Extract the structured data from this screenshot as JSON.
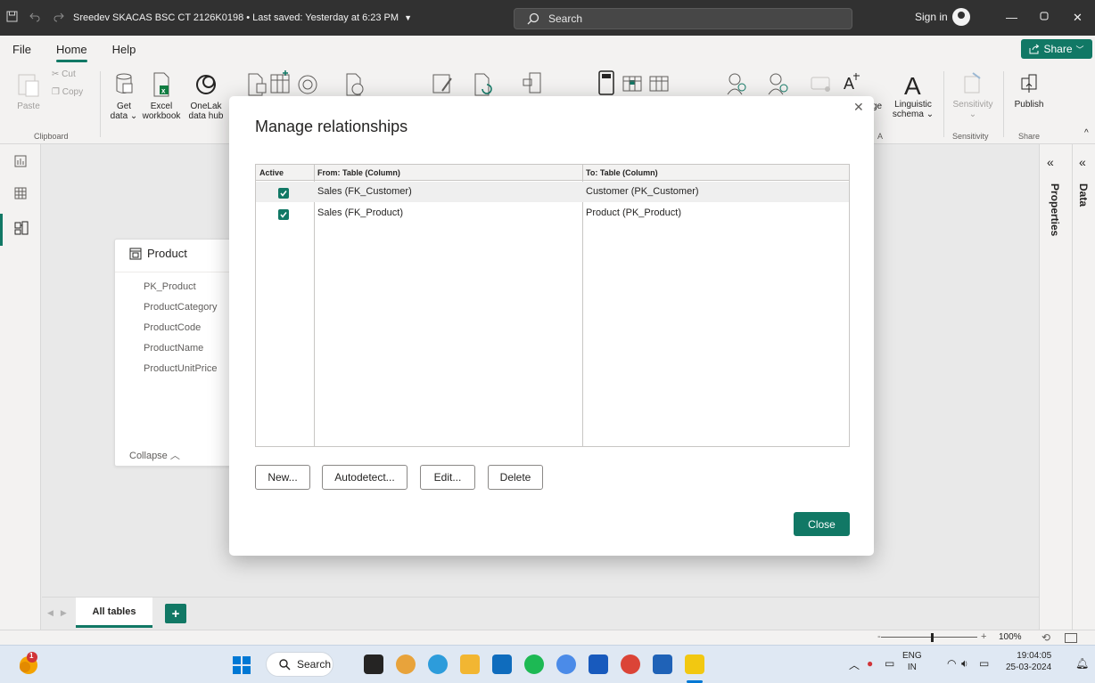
{
  "titlebar": {
    "file_title": "Sreedev SKACAS BSC CT 2126K0198",
    "separator": "•",
    "saved_status": "Last saved: Yesterday at 6:23 PM",
    "search_placeholder": "Search",
    "signin_label": "Sign in"
  },
  "menubar": {
    "items": [
      "File",
      "Home",
      "Help"
    ],
    "active": "Home",
    "share_label": "Share"
  },
  "ribbon": {
    "paste": "Paste",
    "cut": "Cut",
    "copy": "Copy",
    "clipboard_group": "Clipboard",
    "get_data": "Get",
    "get_data_2": "data",
    "excel": "Excel",
    "excel_2": "workbook",
    "onelake": "OneLak",
    "onelake_2": "data hub",
    "language": "ge",
    "linguistic": "Linguistic",
    "linguistic_2": "schema",
    "sensitivity": "Sensitivity",
    "sensitivity_group": "Sensitivity",
    "publish": "Publish",
    "share_group": "Share",
    "a_group_fragment": "A"
  },
  "right_pane": {
    "properties": "Properties",
    "data": "Data"
  },
  "product_card": {
    "title": "Product",
    "fields": [
      "PK_Product",
      "ProductCategory",
      "ProductCode",
      "ProductName",
      "ProductUnitPrice"
    ],
    "collapse": "Collapse"
  },
  "dialog": {
    "title": "Manage relationships",
    "columns": {
      "active": "Active",
      "from": "From: Table (Column)",
      "to": "To: Table (Column)"
    },
    "rows": [
      {
        "active": true,
        "from": "Sales (FK_Customer)",
        "to": "Customer (PK_Customer)"
      },
      {
        "active": true,
        "from": "Sales (FK_Product)",
        "to": "Product (PK_Product)"
      }
    ],
    "buttons": {
      "new": "New...",
      "autodetect": "Autodetect...",
      "edit": "Edit...",
      "delete": "Delete",
      "close": "Close"
    }
  },
  "pagebar": {
    "tab": "All tables",
    "add": "+"
  },
  "statusbar": {
    "zoom_minus": "-",
    "zoom_plus": "+",
    "zoom_pct": "100%"
  },
  "taskbar": {
    "search": "Search",
    "notif_count": "1",
    "lang_1": "ENG",
    "lang_2": "IN",
    "time": "19:04:05",
    "date": "25-03-2024"
  },
  "colors": {
    "accent": "#117865",
    "titlebar": "#313131",
    "ribbon": "#f3f2f1"
  }
}
